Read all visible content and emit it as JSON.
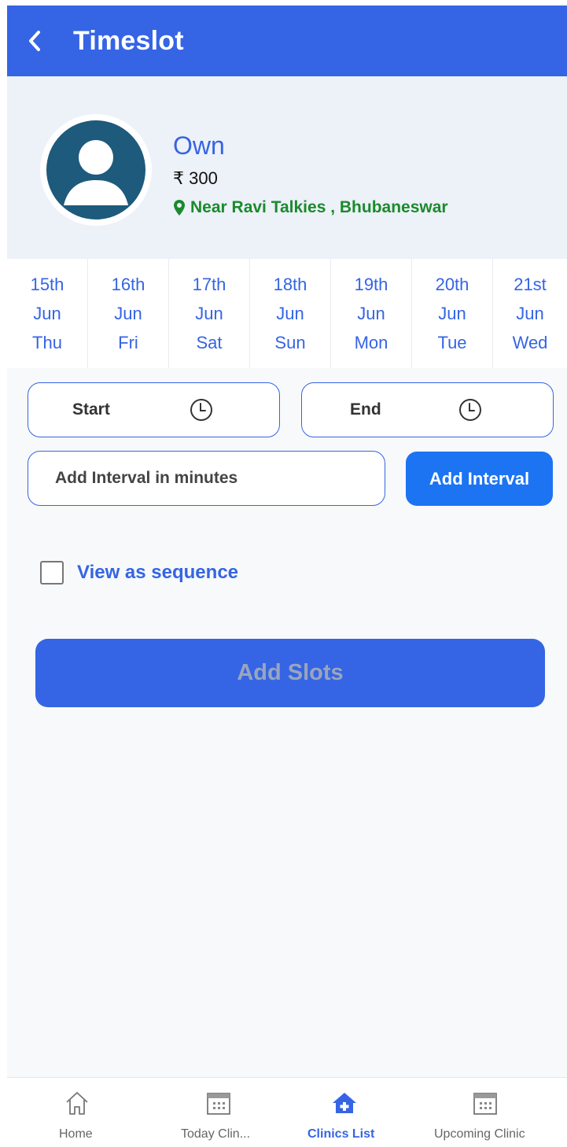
{
  "header": {
    "title": "Timeslot"
  },
  "profile": {
    "name": "Own",
    "fee": "₹ 300",
    "location": "Near Ravi Talkies , Bhubaneswar"
  },
  "dates": [
    {
      "day": "15th",
      "month": "Jun",
      "weekday": "Thu"
    },
    {
      "day": "16th",
      "month": "Jun",
      "weekday": "Fri"
    },
    {
      "day": "17th",
      "month": "Jun",
      "weekday": "Sat"
    },
    {
      "day": "18th",
      "month": "Jun",
      "weekday": "Sun"
    },
    {
      "day": "19th",
      "month": "Jun",
      "weekday": "Mon"
    },
    {
      "day": "20th",
      "month": "Jun",
      "weekday": "Tue"
    },
    {
      "day": "21st",
      "month": "Jun",
      "weekday": "Wed"
    }
  ],
  "form": {
    "start_label": "Start",
    "end_label": "End",
    "interval_placeholder": "Add Interval in minutes",
    "add_interval_label": "Add Interval",
    "sequence_label": "View as sequence",
    "sequence_checked": false,
    "add_slots_label": "Add Slots"
  },
  "nav": {
    "items": [
      {
        "label": "Home",
        "icon": "home-icon"
      },
      {
        "label": "Today Clin...",
        "icon": "calendar-icon"
      },
      {
        "label": "Clinics List",
        "icon": "clinic-home-icon",
        "active": true
      },
      {
        "label": "Upcoming Clinic",
        "icon": "calendar-icon"
      }
    ]
  },
  "colors": {
    "primary": "#3565e4",
    "button_blue": "#1c74f3",
    "location_green": "#1a8a2c",
    "avatar_bg": "#1d5a7c"
  }
}
